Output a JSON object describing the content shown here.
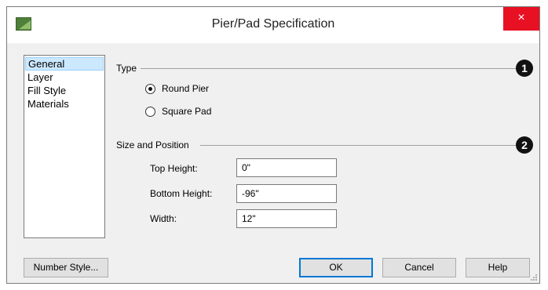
{
  "window": {
    "title": "Pier/Pad Specification",
    "close_glyph": "×",
    "app_icon": "chief-architect-app-icon",
    "close_color": "#e81123"
  },
  "sidebar": {
    "items": [
      {
        "label": "General",
        "selected": true
      },
      {
        "label": "Layer",
        "selected": false
      },
      {
        "label": "Fill Style",
        "selected": false
      },
      {
        "label": "Materials",
        "selected": false
      }
    ]
  },
  "type_group": {
    "label": "Type",
    "callout": "1",
    "options": [
      {
        "label": "Round Pier",
        "checked": true
      },
      {
        "label": "Square Pad",
        "checked": false
      }
    ]
  },
  "size_group": {
    "label": "Size and Position",
    "callout": "2",
    "fields": [
      {
        "label": "Top Height:",
        "value": "0\""
      },
      {
        "label": "Bottom Height:",
        "value": "-96\""
      },
      {
        "label": "Width:",
        "value": "12\""
      }
    ]
  },
  "buttons": {
    "number_style": "Number Style...",
    "ok": "OK",
    "cancel": "Cancel",
    "help": "Help"
  },
  "colors": {
    "selection": "#cce8ff",
    "default_button_border": "#0078d7"
  }
}
